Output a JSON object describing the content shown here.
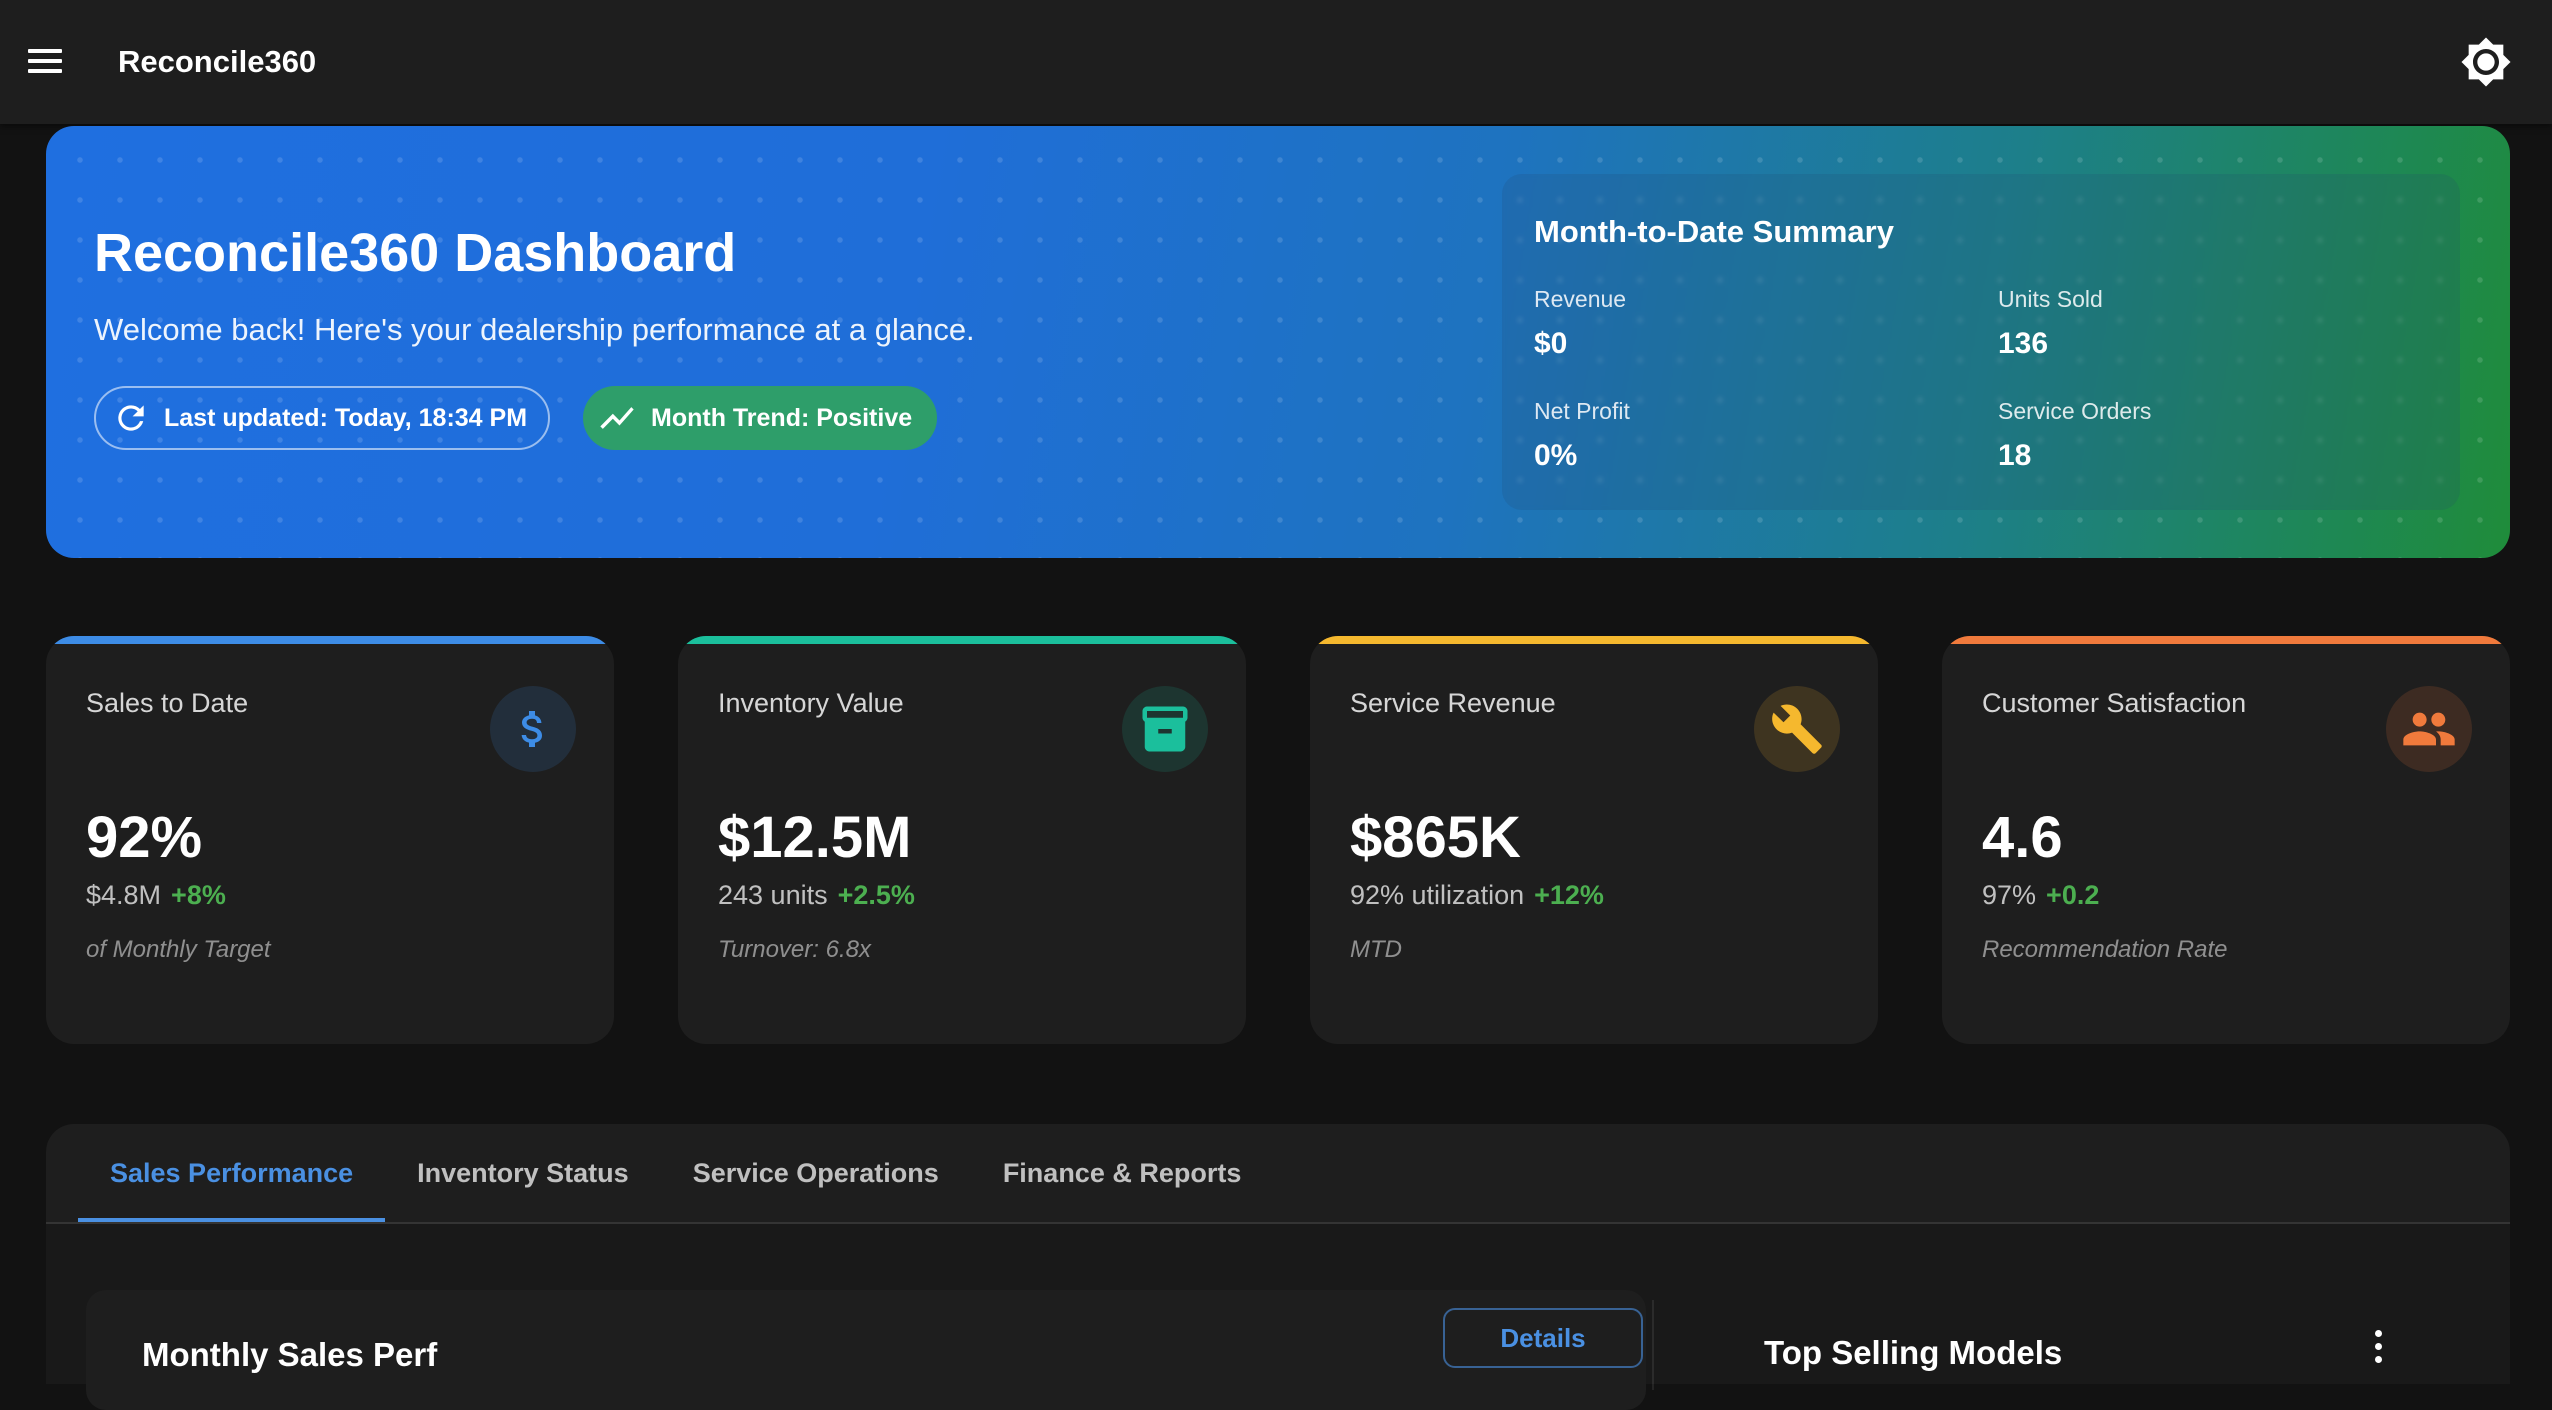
{
  "app": {
    "title": "Reconcile360"
  },
  "hero": {
    "title": "Reconcile360 Dashboard",
    "subtitle": "Welcome back! Here's your dealership performance at a glance.",
    "updated_chip": "Last updated: Today, 18:34 PM",
    "trend_chip": "Month Trend: Positive"
  },
  "mtd": {
    "title": "Month-to-Date Summary",
    "items": [
      {
        "label": "Revenue",
        "value": "$0"
      },
      {
        "label": "Units Sold",
        "value": "136"
      },
      {
        "label": "Net Profit",
        "value": "0%"
      },
      {
        "label": "Service Orders",
        "value": "18"
      }
    ]
  },
  "cards": [
    {
      "label": "Sales to Date",
      "value": "92%",
      "sub": "$4.8M",
      "change": "+8%",
      "note": "of Monthly Target",
      "icon": "dollar-icon",
      "accent": "#3d8ce6",
      "icon_color": "#3d8ce6"
    },
    {
      "label": "Inventory Value",
      "value": "$12.5M",
      "sub": "243 units",
      "change": "+2.5%",
      "note": "Turnover: 6.8x",
      "icon": "archive-icon",
      "accent": "#1bbf9c",
      "icon_color": "#1bbf9c"
    },
    {
      "label": "Service Revenue",
      "value": "$865K",
      "sub": "92% utilization",
      "change": "+12%",
      "note": "MTD",
      "icon": "wrench-icon",
      "accent": "#f5b82e",
      "icon_color": "#f5b82e"
    },
    {
      "label": "Customer Satisfaction",
      "value": "4.6",
      "sub": "97%",
      "change": "+0.2",
      "note": "Recommendation Rate",
      "icon": "people-icon",
      "accent": "#f07a3c",
      "icon_color": "#f07a3c"
    }
  ],
  "tabs": [
    {
      "label": "Sales Performance",
      "active": true
    },
    {
      "label": "Inventory Status",
      "active": false
    },
    {
      "label": "Service Operations",
      "active": false
    },
    {
      "label": "Finance & Reports",
      "active": false
    }
  ],
  "panels": {
    "left_title": "Monthly Sales Perf",
    "details_label": "Details",
    "right_title": "Top Selling Models"
  },
  "colors": {
    "accent": "#4a90e2",
    "positive": "#4caf50",
    "surface": "#1e1e1e",
    "background": "#121212"
  }
}
